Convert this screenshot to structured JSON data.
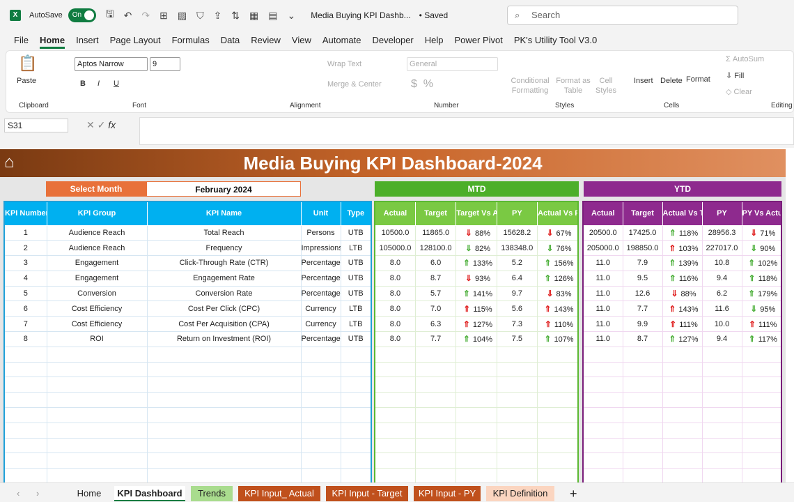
{
  "titlebar": {
    "autosave": "AutoSave",
    "toggle": "On",
    "doc_title": "Media Buying KPI Dashb...",
    "saved": "• Saved",
    "search_placeholder": "Search"
  },
  "menu": [
    "File",
    "Home",
    "Insert",
    "Page Layout",
    "Formulas",
    "Data",
    "Review",
    "View",
    "Automate",
    "Developer",
    "Help",
    "Power Pivot",
    "PK's Utility Tool V3.0"
  ],
  "ribbon": {
    "paste": "Paste",
    "clipboard": "Clipboard",
    "font_name": "Aptos Narrow",
    "font_size": "9",
    "font": "Font",
    "wrap": "Wrap Text",
    "merge": "Merge & Center",
    "alignment": "Alignment",
    "number_format": "General",
    "number": "Number",
    "cond": "Conditional Formatting",
    "format_table": "Format as Table",
    "cell_styles": "Cell Styles",
    "styles": "Styles",
    "insert": "Insert",
    "delete": "Delete",
    "format": "Format",
    "cells": "Cells",
    "autosum": "AutoSum",
    "fill": "Fill",
    "clear": "Clear",
    "editing": "Editing"
  },
  "formula": {
    "namebox": "S31",
    "fx": "fx"
  },
  "dashboard": {
    "title": "Media Buying KPI Dashboard-2024",
    "select_month_label": "Select Month",
    "month": "February 2024",
    "mtd": "MTD",
    "ytd": "YTD",
    "left_headers": [
      "KPI Number",
      "KPI Group",
      "KPI Name",
      "Unit",
      "Type"
    ],
    "mtd_headers": [
      "Actual",
      "Target",
      "Target Vs Actual",
      "PY",
      "Actual Vs PY"
    ],
    "ytd_headers": [
      "Actual",
      "Target",
      "Actual Vs Target",
      "PY",
      "PY Vs Actual"
    ],
    "rows": [
      {
        "num": "1",
        "group": "Audience Reach",
        "name": "Total Reach",
        "unit": "Persons",
        "type": "UTB",
        "mtd": {
          "actual": "10500.0",
          "target": "11865.0",
          "tva_arrow": "down-red",
          "tva": "88%",
          "py": "15628.2",
          "avp_arrow": "down-red",
          "avp": "67%"
        },
        "ytd": {
          "actual": "20500.0",
          "target": "17425.0",
          "avt_arrow": "up-green",
          "avt": "118%",
          "py": "28956.3",
          "pva_arrow": "down-red",
          "pva": "71%"
        }
      },
      {
        "num": "2",
        "group": "Audience Reach",
        "name": "Frequency",
        "unit": "Impressions",
        "type": "LTB",
        "mtd": {
          "actual": "105000.0",
          "target": "128100.0",
          "tva_arrow": "down-green",
          "tva": "82%",
          "py": "138348.0",
          "avp_arrow": "down-green",
          "avp": "76%"
        },
        "ytd": {
          "actual": "205000.0",
          "target": "198850.0",
          "avt_arrow": "up-red",
          "avt": "103%",
          "py": "227017.0",
          "pva_arrow": "down-green",
          "pva": "90%"
        }
      },
      {
        "num": "3",
        "group": "Engagement",
        "name": "Click-Through Rate (CTR)",
        "unit": "Percentage",
        "type": "UTB",
        "mtd": {
          "actual": "8.0",
          "target": "6.0",
          "tva_arrow": "up-green",
          "tva": "133%",
          "py": "5.2",
          "avp_arrow": "up-green",
          "avp": "156%"
        },
        "ytd": {
          "actual": "11.0",
          "target": "7.9",
          "avt_arrow": "up-green",
          "avt": "139%",
          "py": "10.8",
          "pva_arrow": "up-green",
          "pva": "102%"
        }
      },
      {
        "num": "4",
        "group": "Engagement",
        "name": "Engagement Rate",
        "unit": "Percentage",
        "type": "UTB",
        "mtd": {
          "actual": "8.0",
          "target": "8.7",
          "tva_arrow": "down-red",
          "tva": "93%",
          "py": "6.4",
          "avp_arrow": "up-green",
          "avp": "126%"
        },
        "ytd": {
          "actual": "11.0",
          "target": "9.5",
          "avt_arrow": "up-green",
          "avt": "116%",
          "py": "9.4",
          "pva_arrow": "up-green",
          "pva": "118%"
        }
      },
      {
        "num": "5",
        "group": "Conversion",
        "name": "Conversion Rate",
        "unit": "Percentage",
        "type": "UTB",
        "mtd": {
          "actual": "8.0",
          "target": "5.7",
          "tva_arrow": "up-green",
          "tva": "141%",
          "py": "9.7",
          "avp_arrow": "down-red",
          "avp": "83%"
        },
        "ytd": {
          "actual": "11.0",
          "target": "12.6",
          "avt_arrow": "down-red",
          "avt": "88%",
          "py": "6.2",
          "pva_arrow": "up-green",
          "pva": "179%"
        }
      },
      {
        "num": "6",
        "group": "Cost Efficiency",
        "name": "Cost Per Click (CPC)",
        "unit": "Currency",
        "type": "LTB",
        "mtd": {
          "actual": "8.0",
          "target": "7.0",
          "tva_arrow": "up-red",
          "tva": "115%",
          "py": "5.6",
          "avp_arrow": "up-red",
          "avp": "143%"
        },
        "ytd": {
          "actual": "11.0",
          "target": "7.7",
          "avt_arrow": "up-red",
          "avt": "143%",
          "py": "11.6",
          "pva_arrow": "down-green",
          "pva": "95%"
        }
      },
      {
        "num": "7",
        "group": "Cost Efficiency",
        "name": "Cost Per Acquisition (CPA)",
        "unit": "Currency",
        "type": "LTB",
        "mtd": {
          "actual": "8.0",
          "target": "6.3",
          "tva_arrow": "up-red",
          "tva": "127%",
          "py": "7.3",
          "avp_arrow": "up-red",
          "avp": "110%"
        },
        "ytd": {
          "actual": "11.0",
          "target": "9.9",
          "avt_arrow": "up-red",
          "avt": "111%",
          "py": "10.0",
          "pva_arrow": "up-red",
          "pva": "111%"
        }
      },
      {
        "num": "8",
        "group": "ROI",
        "name": "Return on Investment (ROI)",
        "unit": "Percentage",
        "type": "UTB",
        "mtd": {
          "actual": "8.0",
          "target": "7.7",
          "tva_arrow": "up-green",
          "tva": "104%",
          "py": "7.5",
          "avp_arrow": "up-green",
          "avp": "107%"
        },
        "ytd": {
          "actual": "11.0",
          "target": "8.7",
          "avt_arrow": "up-green",
          "avt": "127%",
          "py": "9.4",
          "pva_arrow": "up-green",
          "pva": "117%"
        }
      }
    ]
  },
  "sheet_tabs": [
    {
      "label": "Home",
      "bg": "",
      "color": "#222"
    },
    {
      "label": "KPI Dashboard",
      "bg": "#ffffff",
      "color": "#107c41",
      "active": true
    },
    {
      "label": "Trends",
      "bg": "#a9dc8e",
      "color": "#222"
    },
    {
      "label": "KPI Input_ Actual",
      "bg": "#c0501c",
      "color": "#fff"
    },
    {
      "label": "KPI Input - Target",
      "bg": "#c0501c",
      "color": "#fff"
    },
    {
      "label": "KPI Input - PY",
      "bg": "#c0501c",
      "color": "#fff"
    },
    {
      "label": "KPI Definition",
      "bg": "#fbd5c0",
      "color": "#222"
    }
  ]
}
